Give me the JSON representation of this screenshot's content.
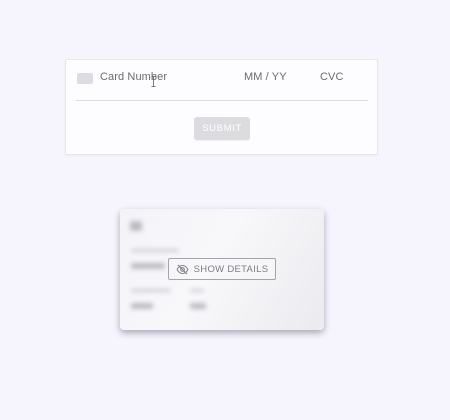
{
  "payment_form": {
    "card_number_placeholder": "Card Number",
    "expiry_placeholder": "MM / YY",
    "cvc_placeholder": "CVC",
    "submit_label": "SUBMIT",
    "card_brand_icon": "generic-card-icon"
  },
  "virtual_card": {
    "reveal_label": "SHOW DETAILS",
    "reveal_icon": "eye-off-icon",
    "details_obscured": true
  }
}
